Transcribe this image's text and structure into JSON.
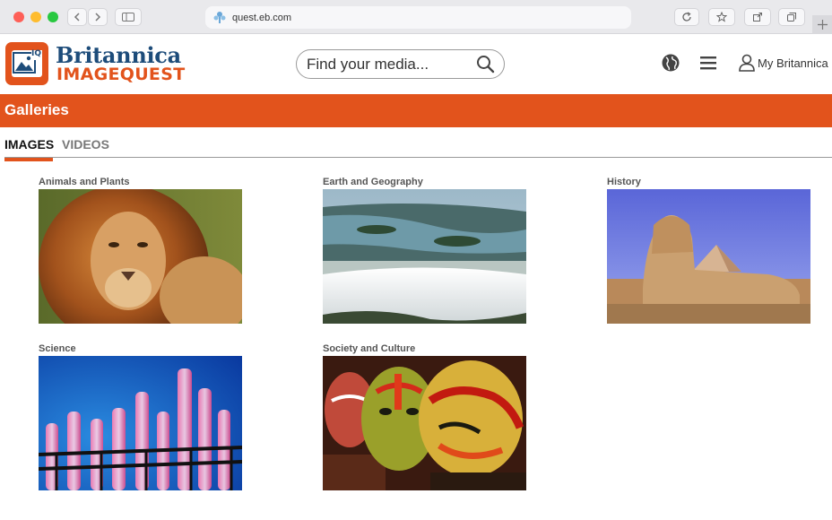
{
  "browser": {
    "url": "quest.eb.com"
  },
  "header": {
    "brand_line1": "Britannica",
    "brand_line2": "IMAGEQUEST",
    "logo_badge": "IQ",
    "search_placeholder": "Find your media...",
    "account_label": "My Britannica"
  },
  "page": {
    "title": "Galleries"
  },
  "tabs": [
    {
      "label": "IMAGES",
      "active": true
    },
    {
      "label": "VIDEOS",
      "active": false
    }
  ],
  "galleries": [
    {
      "label": "Animals and Plants"
    },
    {
      "label": "Earth and Geography"
    },
    {
      "label": "History"
    },
    {
      "label": "Science"
    },
    {
      "label": "Society and Culture"
    }
  ],
  "colors": {
    "accent": "#e2531c",
    "brand_blue": "#1d4c7a"
  }
}
